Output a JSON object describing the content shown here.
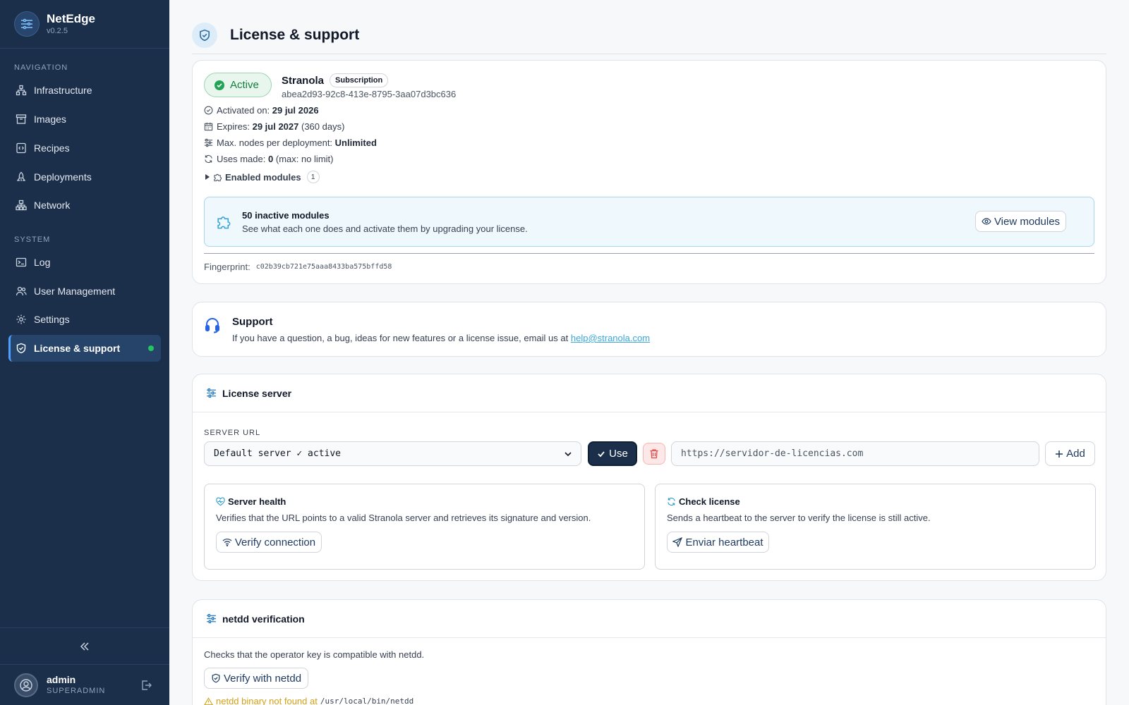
{
  "app": {
    "name": "NetEdge",
    "version": "v0.2.5"
  },
  "sidebar": {
    "nav_heading": "NAVIGATION",
    "system_heading": "SYSTEM",
    "items": [
      {
        "label": "Infrastructure",
        "icon": "infrastructure-icon"
      },
      {
        "label": "Images",
        "icon": "images-icon"
      },
      {
        "label": "Recipes",
        "icon": "recipes-icon"
      },
      {
        "label": "Deployments",
        "icon": "deployments-icon"
      },
      {
        "label": "Network",
        "icon": "network-icon"
      },
      {
        "label": "Log",
        "icon": "terminal-icon"
      },
      {
        "label": "User Management",
        "icon": "users-icon"
      },
      {
        "label": "Settings",
        "icon": "gear-icon"
      },
      {
        "label": "License & support",
        "icon": "shield-icon",
        "active": true
      }
    ],
    "user": {
      "name": "admin",
      "role": "SUPERADMIN"
    }
  },
  "page": {
    "title": "License & support"
  },
  "license": {
    "status": "Active",
    "vendor": "Stranola",
    "type": "Subscription",
    "id": "abea2d93-92c8-413e-8795-3aa07d3bc636",
    "activated_label": "Activated on:",
    "activated_value": "29 jul 2026",
    "expires_label": "Expires:",
    "expires_value": "29 jul 2027",
    "expires_extra": "(360 days)",
    "max_nodes_label": "Max. nodes per deployment:",
    "max_nodes_value": "Unlimited",
    "uses_label": "Uses made:",
    "uses_value": "0",
    "uses_extra": "(max: no limit)",
    "modules_label": "Enabled modules",
    "modules_count": "1",
    "inactive_title": "50 inactive modules",
    "inactive_desc": "See what each one does and activate them by upgrading your license.",
    "view_modules": "View modules",
    "fingerprint_label": "Fingerprint:",
    "fingerprint": "c02b39cb721e75aaa8433ba575bffd58"
  },
  "support": {
    "title": "Support",
    "desc": "If you have a question, a bug, ideas for new features or a license issue, email us at",
    "email": "help@stranola.com"
  },
  "license_server": {
    "title": "License server",
    "url_label": "SERVER URL",
    "selected": "Default server ✓ active",
    "use_label": "Use",
    "url_placeholder": "https://servidor-de-licencias.com",
    "add_label": "Add",
    "health_title": "Server health",
    "health_desc": "Verifies that the URL points to a valid Stranola server and retrieves its signature and version.",
    "verify_label": "Verify connection",
    "check_title": "Check license",
    "check_desc": "Sends a heartbeat to the server to verify the license is still active.",
    "heartbeat_label": "Enviar heartbeat"
  },
  "netdd": {
    "title": "netdd verification",
    "desc": "Checks that the operator key is compatible with netdd.",
    "verify_label": "Verify with netdd",
    "warn_text": "netdd binary not found at",
    "warn_path": "/usr/local/bin/netdd"
  },
  "colors": {
    "sidebar": "#1b2f4b",
    "accent": "#38a8d8",
    "success": "#22a355",
    "danger": "#e24c4c",
    "warning": "#d4a017"
  }
}
